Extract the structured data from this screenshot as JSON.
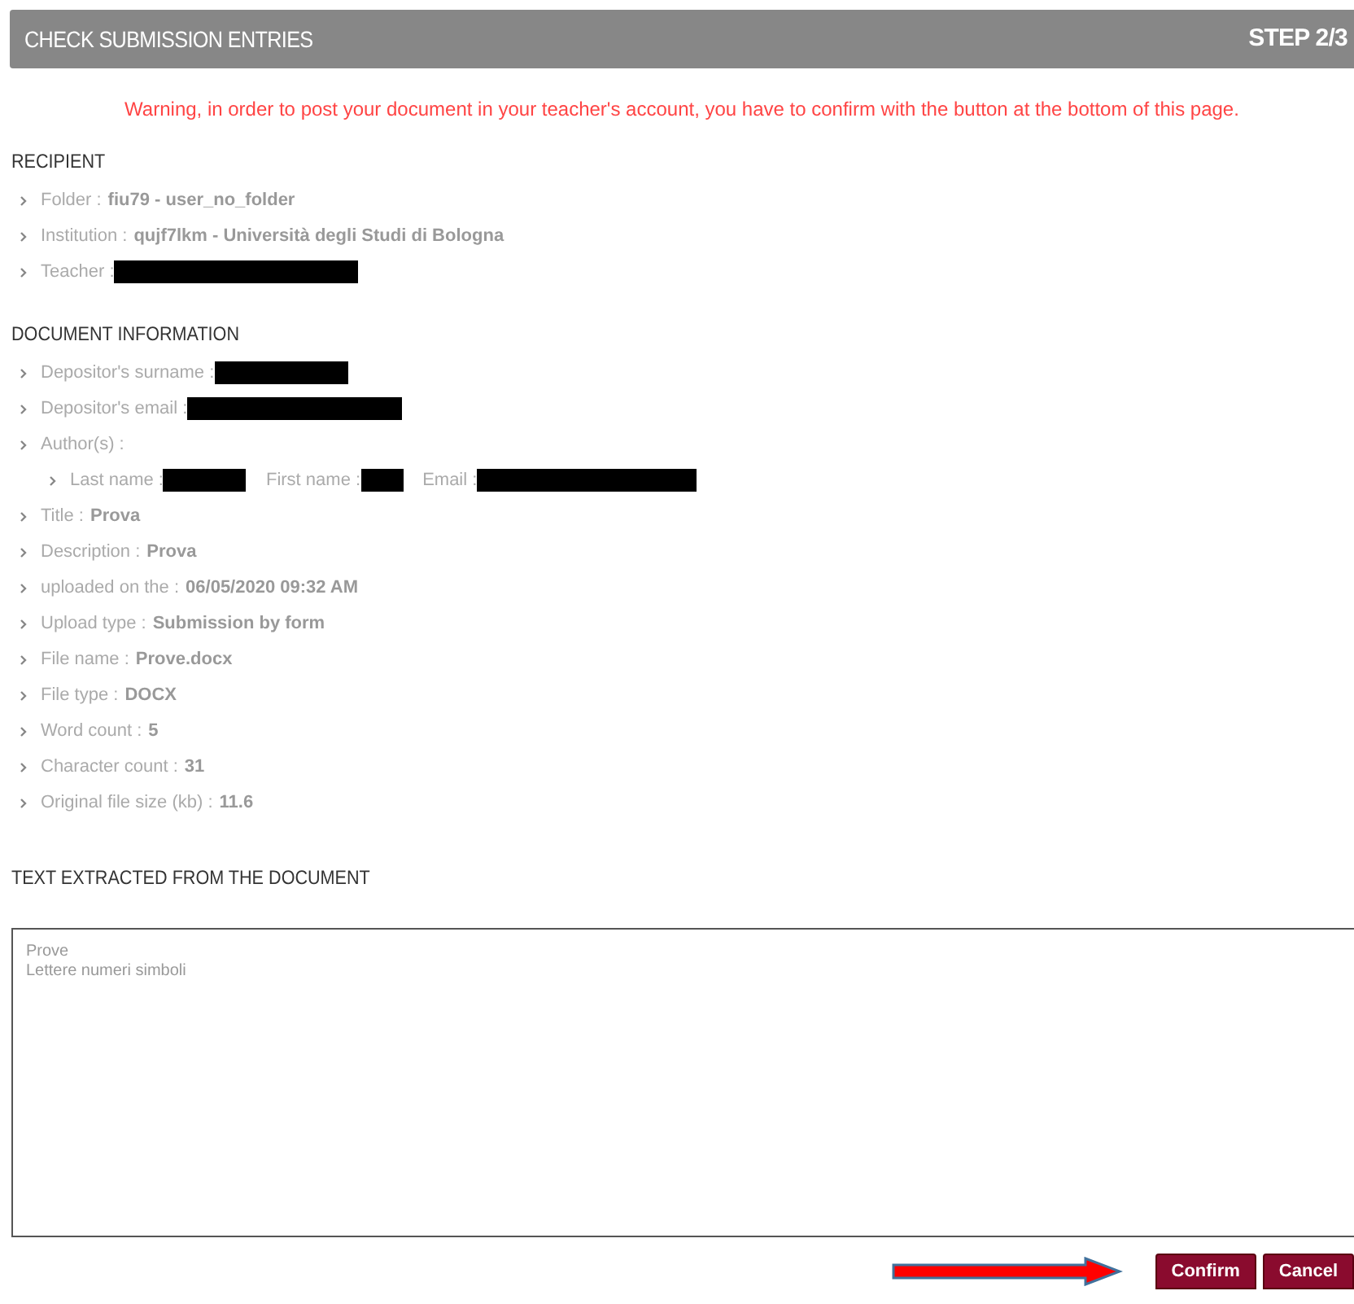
{
  "header": {
    "title": "CHECK SUBMISSION ENTRIES",
    "step": "STEP 2/3"
  },
  "warning": "Warning, in order to post your document in your teacher's account, you have to confirm with the button at the bottom of this page.",
  "sections": [
    {
      "title": "RECIPIENT",
      "items": [
        {
          "label": "Folder :",
          "value": "fiu79 - user_no_folder"
        },
        {
          "label": "Institution :",
          "value": "qujf7lkm - Università degli Studi di Bologna"
        },
        {
          "label": "Teacher :",
          "redacted": true
        }
      ]
    },
    {
      "title": "DOCUMENT INFORMATION",
      "items": [
        {
          "label": "Depositor's surname :",
          "redacted": true
        },
        {
          "label": "Depositor's email :",
          "redacted": true
        },
        {
          "label": "Author(s) :",
          "children": [
            {
              "parts": [
                {
                  "label": "Last name :",
                  "redacted": true
                },
                {
                  "label": "First name :",
                  "redacted": true
                },
                {
                  "label": "Email :",
                  "redacted": true
                }
              ]
            }
          ]
        },
        {
          "label": "Title :",
          "value": "Prova"
        },
        {
          "label": "Description :",
          "value": "Prova"
        },
        {
          "label": "uploaded on the :",
          "value": "06/05/2020 09:32 AM"
        },
        {
          "label": "Upload type :",
          "value": "Submission by form"
        },
        {
          "label": "File name :",
          "value": "Prove.docx"
        },
        {
          "label": "File type :",
          "value": "DOCX"
        },
        {
          "label": "Word count :",
          "value": "5"
        },
        {
          "label": "Character count :",
          "value": "31"
        },
        {
          "label": "Original file size (kb) :",
          "value": "11.6"
        }
      ]
    }
  ],
  "extracted": {
    "title": "TEXT EXTRACTED FROM THE DOCUMENT",
    "lines": [
      "Prove",
      "Lettere numeri simboli"
    ]
  },
  "buttons": [
    "Confirm",
    "Cancel"
  ]
}
